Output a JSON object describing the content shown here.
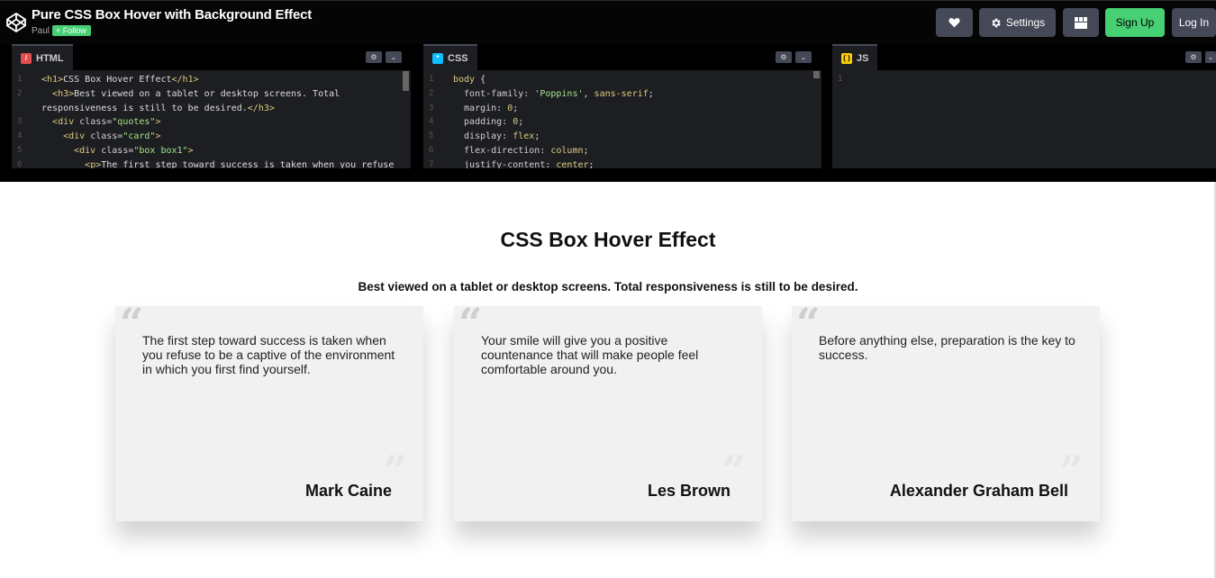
{
  "header": {
    "title": "Pure CSS Box Hover with Background Effect",
    "author": "Paul",
    "follow_label": "+ Follow",
    "settings_label": "Settings",
    "signup_label": "Sign Up",
    "login_label": "Log In",
    "accent": "#47cf73"
  },
  "editors": {
    "html_tab": "HTML",
    "css_tab": "CSS",
    "js_tab": "JS",
    "html_lines": [
      {
        "n": "1",
        "parts": [
          [
            "tag",
            "<h1>"
          ],
          [
            "plain",
            "CSS Box Hover Effect"
          ],
          [
            "tag",
            "</h1>"
          ]
        ]
      },
      {
        "n": "2",
        "parts": [
          [
            "plain",
            "  "
          ],
          [
            "tag",
            "<h3>"
          ],
          [
            "plain",
            "Best viewed on a tablet or desktop screens. Total"
          ]
        ]
      },
      {
        "n": "",
        "parts": [
          [
            "plain",
            "responsiveness is still to be desired."
          ],
          [
            "tag",
            "</h3>"
          ]
        ]
      },
      {
        "n": "3",
        "parts": [
          [
            "plain",
            "  "
          ],
          [
            "tag",
            "<div "
          ],
          [
            "attr",
            "class="
          ],
          [
            "str",
            "\"quotes\""
          ],
          [
            "tag",
            ">"
          ]
        ]
      },
      {
        "n": "4",
        "parts": [
          [
            "plain",
            "    "
          ],
          [
            "tag",
            "<div "
          ],
          [
            "attr",
            "class="
          ],
          [
            "str",
            "\"card\""
          ],
          [
            "tag",
            ">"
          ]
        ]
      },
      {
        "n": "5",
        "parts": [
          [
            "plain",
            "      "
          ],
          [
            "tag",
            "<div "
          ],
          [
            "attr",
            "class="
          ],
          [
            "str",
            "\"box box1\""
          ],
          [
            "tag",
            ">"
          ]
        ]
      },
      {
        "n": "6",
        "parts": [
          [
            "plain",
            "        "
          ],
          [
            "tag",
            "<p>"
          ],
          [
            "plain",
            "The first step toward success is taken when you refuse"
          ]
        ]
      }
    ],
    "css_lines": [
      {
        "n": "1",
        "parts": [
          [
            "val",
            "body "
          ],
          [
            "plain",
            "{"
          ]
        ]
      },
      {
        "n": "2",
        "parts": [
          [
            "prop",
            "  font-family: "
          ],
          [
            "str",
            "'Poppins'"
          ],
          [
            "plain",
            ", "
          ],
          [
            "val",
            "sans-serif"
          ],
          [
            "plain",
            ";"
          ]
        ]
      },
      {
        "n": "3",
        "parts": [
          [
            "prop",
            "  margin: "
          ],
          [
            "val",
            "0"
          ],
          [
            "plain",
            ";"
          ]
        ]
      },
      {
        "n": "4",
        "parts": [
          [
            "prop",
            "  padding: "
          ],
          [
            "val",
            "0"
          ],
          [
            "plain",
            ";"
          ]
        ]
      },
      {
        "n": "5",
        "parts": [
          [
            "prop",
            "  display: "
          ],
          [
            "val",
            "flex"
          ],
          [
            "plain",
            ";"
          ]
        ]
      },
      {
        "n": "6",
        "parts": [
          [
            "prop",
            "  flex-direction: "
          ],
          [
            "val",
            "column"
          ],
          [
            "plain",
            ";"
          ]
        ]
      },
      {
        "n": "7",
        "parts": [
          [
            "prop",
            "  justify-content: "
          ],
          [
            "val",
            "center"
          ],
          [
            "plain",
            ";"
          ]
        ]
      }
    ],
    "js_lines": [
      {
        "n": "1",
        "parts": []
      }
    ]
  },
  "preview": {
    "heading": "CSS Box Hover Effect",
    "subheading": "Best viewed on a tablet or desktop screens. Total responsiveness is still to be desired.",
    "open_quote": "“",
    "close_quote": "”",
    "cards": [
      {
        "quote": "The first step toward success is taken when you refuse to be a captive of the environment in which you first find yourself.",
        "author": "Mark Caine"
      },
      {
        "quote": "Your smile will give you a positive countenance that will make people feel comfortable around you.",
        "author": "Les Brown"
      },
      {
        "quote": "Before anything else, preparation is the key to success.",
        "author": "Alexander Graham Bell"
      }
    ]
  }
}
